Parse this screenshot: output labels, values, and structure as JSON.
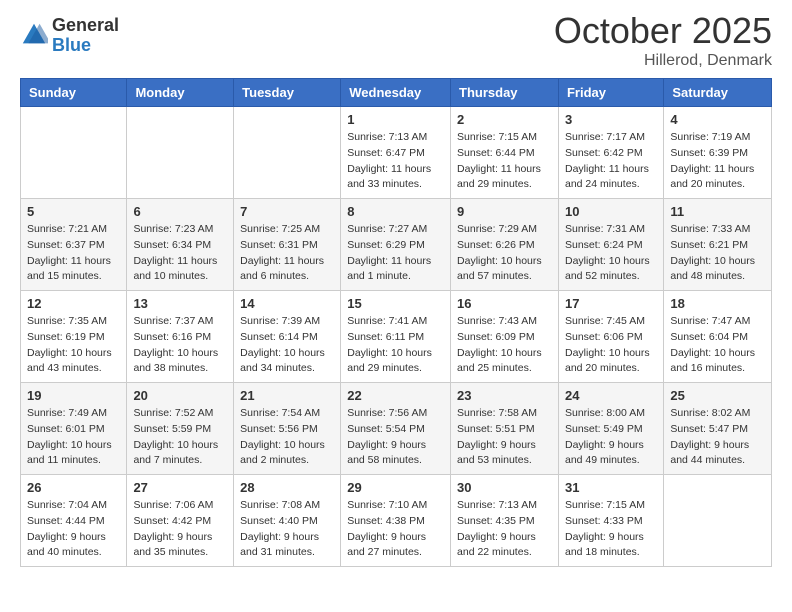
{
  "header": {
    "logo": {
      "general": "General",
      "blue": "Blue"
    },
    "title": "October 2025",
    "location": "Hillerod, Denmark"
  },
  "calendar": {
    "days_of_week": [
      "Sunday",
      "Monday",
      "Tuesday",
      "Wednesday",
      "Thursday",
      "Friday",
      "Saturday"
    ],
    "weeks": [
      [
        {
          "num": "",
          "sunrise": "",
          "sunset": "",
          "daylight": ""
        },
        {
          "num": "",
          "sunrise": "",
          "sunset": "",
          "daylight": ""
        },
        {
          "num": "",
          "sunrise": "",
          "sunset": "",
          "daylight": ""
        },
        {
          "num": "1",
          "sunrise": "Sunrise: 7:13 AM",
          "sunset": "Sunset: 6:47 PM",
          "daylight": "Daylight: 11 hours and 33 minutes."
        },
        {
          "num": "2",
          "sunrise": "Sunrise: 7:15 AM",
          "sunset": "Sunset: 6:44 PM",
          "daylight": "Daylight: 11 hours and 29 minutes."
        },
        {
          "num": "3",
          "sunrise": "Sunrise: 7:17 AM",
          "sunset": "Sunset: 6:42 PM",
          "daylight": "Daylight: 11 hours and 24 minutes."
        },
        {
          "num": "4",
          "sunrise": "Sunrise: 7:19 AM",
          "sunset": "Sunset: 6:39 PM",
          "daylight": "Daylight: 11 hours and 20 minutes."
        }
      ],
      [
        {
          "num": "5",
          "sunrise": "Sunrise: 7:21 AM",
          "sunset": "Sunset: 6:37 PM",
          "daylight": "Daylight: 11 hours and 15 minutes."
        },
        {
          "num": "6",
          "sunrise": "Sunrise: 7:23 AM",
          "sunset": "Sunset: 6:34 PM",
          "daylight": "Daylight: 11 hours and 10 minutes."
        },
        {
          "num": "7",
          "sunrise": "Sunrise: 7:25 AM",
          "sunset": "Sunset: 6:31 PM",
          "daylight": "Daylight: 11 hours and 6 minutes."
        },
        {
          "num": "8",
          "sunrise": "Sunrise: 7:27 AM",
          "sunset": "Sunset: 6:29 PM",
          "daylight": "Daylight: 11 hours and 1 minute."
        },
        {
          "num": "9",
          "sunrise": "Sunrise: 7:29 AM",
          "sunset": "Sunset: 6:26 PM",
          "daylight": "Daylight: 10 hours and 57 minutes."
        },
        {
          "num": "10",
          "sunrise": "Sunrise: 7:31 AM",
          "sunset": "Sunset: 6:24 PM",
          "daylight": "Daylight: 10 hours and 52 minutes."
        },
        {
          "num": "11",
          "sunrise": "Sunrise: 7:33 AM",
          "sunset": "Sunset: 6:21 PM",
          "daylight": "Daylight: 10 hours and 48 minutes."
        }
      ],
      [
        {
          "num": "12",
          "sunrise": "Sunrise: 7:35 AM",
          "sunset": "Sunset: 6:19 PM",
          "daylight": "Daylight: 10 hours and 43 minutes."
        },
        {
          "num": "13",
          "sunrise": "Sunrise: 7:37 AM",
          "sunset": "Sunset: 6:16 PM",
          "daylight": "Daylight: 10 hours and 38 minutes."
        },
        {
          "num": "14",
          "sunrise": "Sunrise: 7:39 AM",
          "sunset": "Sunset: 6:14 PM",
          "daylight": "Daylight: 10 hours and 34 minutes."
        },
        {
          "num": "15",
          "sunrise": "Sunrise: 7:41 AM",
          "sunset": "Sunset: 6:11 PM",
          "daylight": "Daylight: 10 hours and 29 minutes."
        },
        {
          "num": "16",
          "sunrise": "Sunrise: 7:43 AM",
          "sunset": "Sunset: 6:09 PM",
          "daylight": "Daylight: 10 hours and 25 minutes."
        },
        {
          "num": "17",
          "sunrise": "Sunrise: 7:45 AM",
          "sunset": "Sunset: 6:06 PM",
          "daylight": "Daylight: 10 hours and 20 minutes."
        },
        {
          "num": "18",
          "sunrise": "Sunrise: 7:47 AM",
          "sunset": "Sunset: 6:04 PM",
          "daylight": "Daylight: 10 hours and 16 minutes."
        }
      ],
      [
        {
          "num": "19",
          "sunrise": "Sunrise: 7:49 AM",
          "sunset": "Sunset: 6:01 PM",
          "daylight": "Daylight: 10 hours and 11 minutes."
        },
        {
          "num": "20",
          "sunrise": "Sunrise: 7:52 AM",
          "sunset": "Sunset: 5:59 PM",
          "daylight": "Daylight: 10 hours and 7 minutes."
        },
        {
          "num": "21",
          "sunrise": "Sunrise: 7:54 AM",
          "sunset": "Sunset: 5:56 PM",
          "daylight": "Daylight: 10 hours and 2 minutes."
        },
        {
          "num": "22",
          "sunrise": "Sunrise: 7:56 AM",
          "sunset": "Sunset: 5:54 PM",
          "daylight": "Daylight: 9 hours and 58 minutes."
        },
        {
          "num": "23",
          "sunrise": "Sunrise: 7:58 AM",
          "sunset": "Sunset: 5:51 PM",
          "daylight": "Daylight: 9 hours and 53 minutes."
        },
        {
          "num": "24",
          "sunrise": "Sunrise: 8:00 AM",
          "sunset": "Sunset: 5:49 PM",
          "daylight": "Daylight: 9 hours and 49 minutes."
        },
        {
          "num": "25",
          "sunrise": "Sunrise: 8:02 AM",
          "sunset": "Sunset: 5:47 PM",
          "daylight": "Daylight: 9 hours and 44 minutes."
        }
      ],
      [
        {
          "num": "26",
          "sunrise": "Sunrise: 7:04 AM",
          "sunset": "Sunset: 4:44 PM",
          "daylight": "Daylight: 9 hours and 40 minutes."
        },
        {
          "num": "27",
          "sunrise": "Sunrise: 7:06 AM",
          "sunset": "Sunset: 4:42 PM",
          "daylight": "Daylight: 9 hours and 35 minutes."
        },
        {
          "num": "28",
          "sunrise": "Sunrise: 7:08 AM",
          "sunset": "Sunset: 4:40 PM",
          "daylight": "Daylight: 9 hours and 31 minutes."
        },
        {
          "num": "29",
          "sunrise": "Sunrise: 7:10 AM",
          "sunset": "Sunset: 4:38 PM",
          "daylight": "Daylight: 9 hours and 27 minutes."
        },
        {
          "num": "30",
          "sunrise": "Sunrise: 7:13 AM",
          "sunset": "Sunset: 4:35 PM",
          "daylight": "Daylight: 9 hours and 22 minutes."
        },
        {
          "num": "31",
          "sunrise": "Sunrise: 7:15 AM",
          "sunset": "Sunset: 4:33 PM",
          "daylight": "Daylight: 9 hours and 18 minutes."
        },
        {
          "num": "",
          "sunrise": "",
          "sunset": "",
          "daylight": ""
        }
      ]
    ]
  }
}
